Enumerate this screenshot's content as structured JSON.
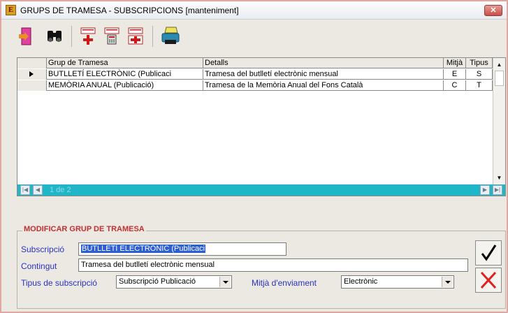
{
  "window": {
    "title": "GRUPS DE TRAMESA - SUBSCRIPCIONS [manteniment]",
    "app_icon_letter": "E",
    "close_label": "✕"
  },
  "toolbar": {
    "buttons": [
      {
        "name": "exit-icon"
      },
      {
        "name": "binoculars-search-icon"
      },
      {
        "name": "add-record-icon"
      },
      {
        "name": "delete-record-icon"
      },
      {
        "name": "edit-record-icon"
      },
      {
        "name": "print-icon"
      }
    ]
  },
  "grid": {
    "columns": [
      "",
      "Grup de Tramesa",
      "Detalls",
      "Mitjà",
      "Tipus"
    ],
    "rows": [
      {
        "group": "BUTLLETÍ ELECTRÒNIC (Publicaci",
        "details": "Tramesa del butlletí electrònic mensual",
        "medium": "E",
        "type": "S"
      },
      {
        "group": "MEMÒRIA ANUAL (Publicació)",
        "details": "Tramesa de la Memòria Anual del Fons Català",
        "medium": "C",
        "type": "T"
      }
    ],
    "record_position": "1 de 2"
  },
  "form": {
    "title": "MODIFICAR GRUP DE TRAMESA",
    "subscription_label": "Subscripció",
    "subscription_value": "BUTLLETÍ ELECTRÒNIC (Publicaci",
    "content_label": "Contingut",
    "content_value": "Tramesa del butlletí electrònic mensual",
    "type_label": "Tipus de subscripció",
    "type_value": "Subscripció Publicació",
    "medium_label": "Mitjà d'enviament",
    "medium_value": "Electrònic"
  },
  "colors": {
    "accent_red": "#c03030",
    "label_blue": "#2a32c0",
    "nav_teal": "#1fb6c8",
    "selection_blue": "#2d5fd0"
  }
}
